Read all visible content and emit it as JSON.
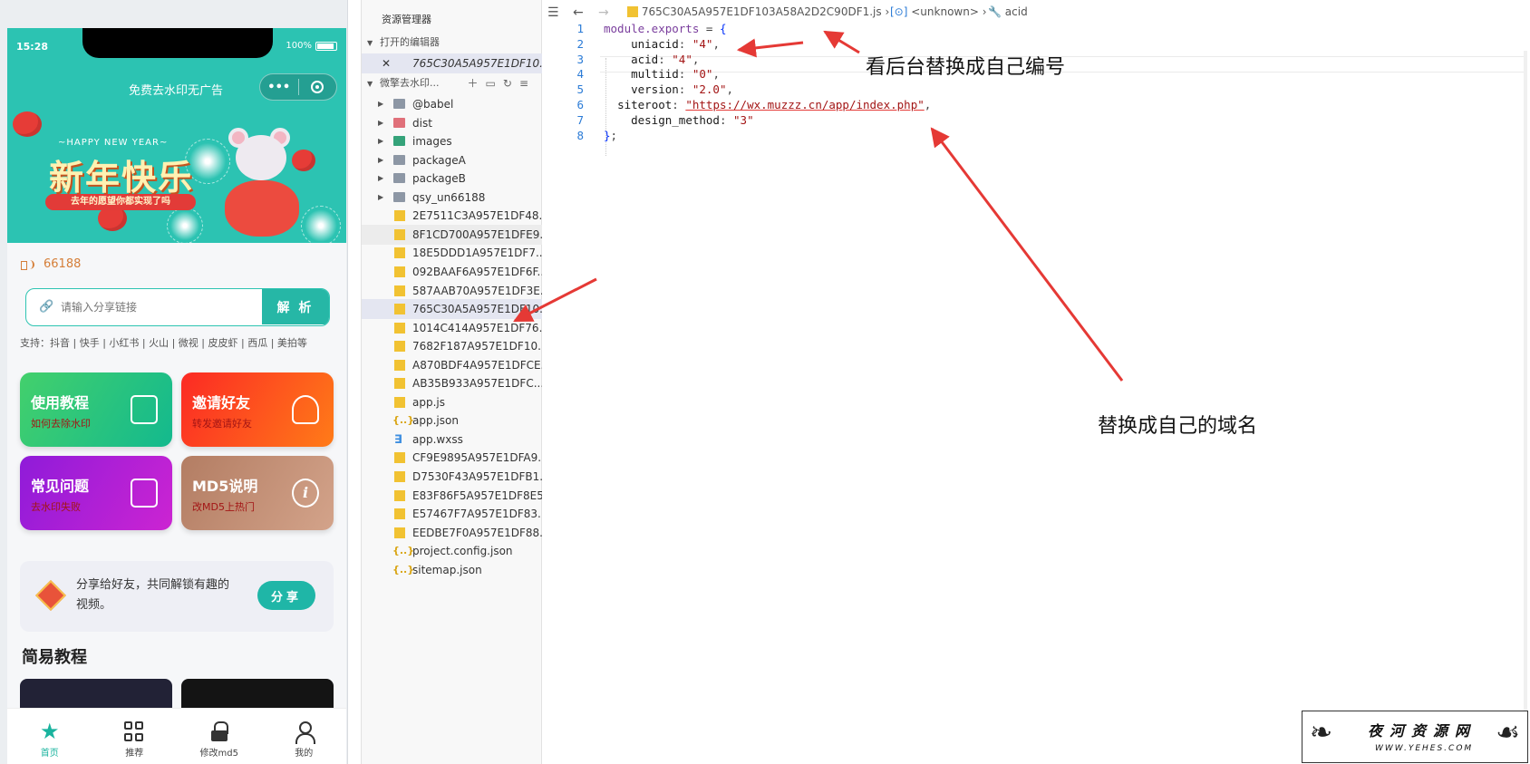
{
  "phone": {
    "status_time": "15:28",
    "status_battery": "100%",
    "app_title": "免费去水印无广告",
    "capsule_more": "•••",
    "banner_small": "~HAPPY NEW YEAR~",
    "banner_big": "新年快乐",
    "banner_ribbon": "去年的愿望你都实现了吗",
    "notice_number": "66188",
    "search_placeholder": "请输入分享链接",
    "parse_button": "解 析",
    "support_text": "支持：抖音 | 快手 | 小红书 | 火山 | 微视 | 皮皮虾 | 西瓜 | 美拍等",
    "cards": [
      {
        "title": "使用教程",
        "subtitle": "如何去除水印"
      },
      {
        "title": "邀请好友",
        "subtitle": "转发邀请好友"
      },
      {
        "title": "常见问题",
        "subtitle": "去水印失败"
      },
      {
        "title": "MD5说明",
        "subtitle": "改MD5上热门",
        "icon_glyph": "i"
      }
    ],
    "share_text": "分享给好友，共同解锁有趣的视频。",
    "share_button": "分享",
    "section_title": "简易教程",
    "tabs": [
      {
        "label": "首页",
        "icon": "star-icon",
        "active": true
      },
      {
        "label": "推荐",
        "icon": "grid-icon",
        "active": false
      },
      {
        "label": "修改md5",
        "icon": "lock-icon",
        "active": false
      },
      {
        "label": "我的",
        "icon": "user-icon",
        "active": false
      }
    ]
  },
  "explorer": {
    "title": "资源管理器",
    "open_editors": "打开的编辑器",
    "open_file": "765C30A5A957E1DF10...",
    "close_glyph": "✕",
    "project": "微擎去水印...",
    "items": [
      {
        "name": "@babel",
        "type": "folder"
      },
      {
        "name": "dist",
        "type": "folder-red"
      },
      {
        "name": "images",
        "type": "folder-green"
      },
      {
        "name": "packageA",
        "type": "folder"
      },
      {
        "name": "packageB",
        "type": "folder"
      },
      {
        "name": "qsy_un66188",
        "type": "folder"
      },
      {
        "name": "2E7511C3A957E1DF48...",
        "type": "js"
      },
      {
        "name": "8F1CD700A957E1DFE9...",
        "type": "js"
      },
      {
        "name": "18E5DDD1A957E1DF7...",
        "type": "js"
      },
      {
        "name": "092BAAF6A957E1DF6F...",
        "type": "js"
      },
      {
        "name": "587AAB70A957E1DF3E...",
        "type": "js"
      },
      {
        "name": "765C30A5A957E1DF10...",
        "type": "js"
      },
      {
        "name": "1014C414A957E1DF76...",
        "type": "js"
      },
      {
        "name": "7682F187A957E1DF10...",
        "type": "js"
      },
      {
        "name": "A870BDF4A957E1DFCE...",
        "type": "js"
      },
      {
        "name": "AB35B933A957E1DFC...",
        "type": "js"
      },
      {
        "name": "app.js",
        "type": "js"
      },
      {
        "name": "app.json",
        "type": "json"
      },
      {
        "name": "app.wxss",
        "type": "css"
      },
      {
        "name": "CF9E9895A957E1DFA9...",
        "type": "js"
      },
      {
        "name": "D7530F43A957E1DFB1...",
        "type": "js"
      },
      {
        "name": "E83F86F5A957E1DF8E5...",
        "type": "js"
      },
      {
        "name": "E57467F7A957E1DF83...",
        "type": "js"
      },
      {
        "name": "EEDBE7F0A957E1DF88...",
        "type": "js"
      },
      {
        "name": "project.config.json",
        "type": "json"
      },
      {
        "name": "sitemap.json",
        "type": "json"
      }
    ]
  },
  "editor": {
    "breadcrumb_file": "765C30A5A957E1DF103A58A2D2C90DF1.js",
    "breadcrumb_scope": "<unknown>",
    "breadcrumb_symbol": "acid",
    "lines": [
      {
        "n": "1",
        "prop": "module.exports",
        "op": " = ",
        "bracket": "{"
      },
      {
        "n": "2",
        "indent": "    ",
        "prop": "uniacid",
        "value": "\"4\"",
        "trail": ","
      },
      {
        "n": "3",
        "indent": "    ",
        "prop": "acid",
        "value": "\"4\"",
        "trail": ","
      },
      {
        "n": "4",
        "indent": "    ",
        "prop": "multiid",
        "value": "\"0\"",
        "trail": ","
      },
      {
        "n": "5",
        "indent": "    ",
        "prop": "version",
        "value": "\"2.0\"",
        "trail": ","
      },
      {
        "n": "6",
        "indent": "  ",
        "prop": "siteroot",
        "value": "\"https://wx.muzzz.cn/app/index.php\"",
        "trail": ","
      },
      {
        "n": "7",
        "indent": "    ",
        "prop": "design_method",
        "value": "\"3\"",
        "trail": ""
      },
      {
        "n": "8",
        "bracket": "}",
        "trail": ";"
      }
    ]
  },
  "annotations": {
    "top": "看后台替换成自己编号",
    "bottom": "替换成自己的域名"
  },
  "watermark": {
    "main": "夜河资源网",
    "sub": "WWW.YEHES.COM"
  },
  "colors": {
    "accent": "#2cc3b2",
    "arrow": "#e53935"
  }
}
